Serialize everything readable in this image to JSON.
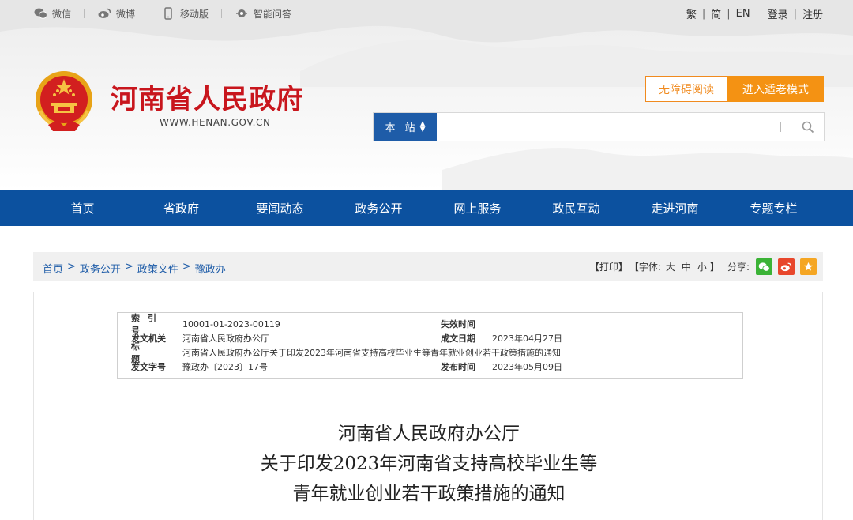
{
  "topbar": {
    "links": [
      {
        "label": "微信",
        "icon": "wechat-icon"
      },
      {
        "label": "微博",
        "icon": "weibo-icon"
      },
      {
        "label": "移动版",
        "icon": "mobile-icon"
      },
      {
        "label": "智能问答",
        "icon": "assistant-icon"
      }
    ],
    "lang_trad": "繁",
    "lang_simp": "简",
    "lang_en": "EN",
    "login": "登录",
    "register": "注册"
  },
  "site": {
    "title": "河南省人民政府",
    "url": "WWW.HENAN.GOV.CN"
  },
  "buttons": {
    "accessible": "无障碍阅读",
    "elder_mode": "进入适老模式"
  },
  "search": {
    "scope": "本 站",
    "placeholder": "",
    "value": ""
  },
  "nav": {
    "items": [
      "首页",
      "省政府",
      "要闻动态",
      "政务公开",
      "网上服务",
      "政民互动",
      "走进河南",
      "专题专栏"
    ]
  },
  "breadcrumb": {
    "items": [
      "首页",
      "政务公开",
      "政策文件",
      "豫政办"
    ],
    "separator": ">"
  },
  "tools": {
    "print": "【打印】",
    "font_label": "【字体:",
    "font_large": "大",
    "font_medium": "中",
    "font_small": "小",
    "font_close": "】",
    "share_label": "分享:"
  },
  "meta": {
    "index_label": "索引号",
    "index_value": "10001-01-2023-00119",
    "expire_label": "失效时间",
    "expire_value": "",
    "issuer_label": "发文机关",
    "issuer_value": "河南省人民政府办公厅",
    "created_label": "成文日期",
    "created_value": "2023年04月27日",
    "title_label": "标题",
    "title_value": "河南省人民政府办公厅关于印发2023年河南省支持高校毕业生等青年就业创业若干政策措施的通知",
    "docno_label": "发文字号",
    "docno_value": "豫政办〔2023〕17号",
    "published_label": "发布时间",
    "published_value": "2023年05月09日"
  },
  "document": {
    "title_line1": "河南省人民政府办公厅",
    "title_line2": "关于印发2023年河南省支持高校毕业生等",
    "title_line3": "青年就业创业若干政策措施的通知"
  },
  "colors": {
    "brand_red": "#c8161d",
    "nav_blue": "#0c519f",
    "link_blue": "#1e5ca8",
    "accent_orange": "#f49213"
  }
}
